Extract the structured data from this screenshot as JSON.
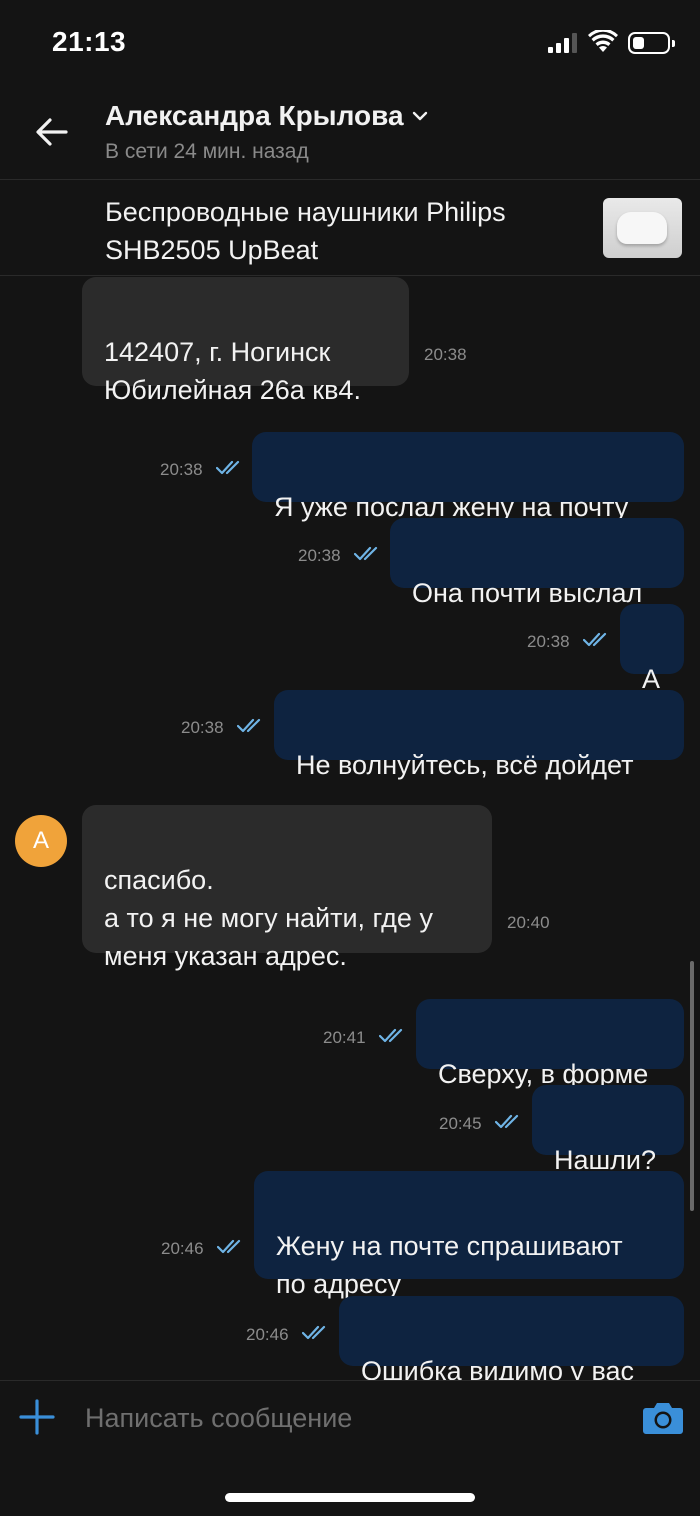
{
  "status_bar": {
    "time": "21:13",
    "battery_level": 0.35
  },
  "header": {
    "contact_name": "Александра Крылова",
    "contact_status": "В сети 24 мин. назад",
    "icons": [
      "back-arrow-icon",
      "chevron-down-icon"
    ]
  },
  "product": {
    "title": "Беспроводные наушники Philips SHB2505 UpBeat"
  },
  "avatar_letter": "А",
  "messages": [
    {
      "direction": "in",
      "text": "142407, г. Ногинск\nЮбилейная 26а кв4.",
      "time": "20:38"
    },
    {
      "direction": "out",
      "text": "Я уже послал жену на почту",
      "time": "20:38",
      "read": true
    },
    {
      "direction": "out",
      "text": "Она почти выслал",
      "time": "20:38",
      "read": true
    },
    {
      "direction": "out",
      "text": "А",
      "time": "20:38",
      "read": true
    },
    {
      "direction": "out",
      "text": "Не волнуйтесь, всё дойдет",
      "time": "20:38",
      "read": true
    },
    {
      "direction": "in",
      "text": "спасибо.\nа то я не могу найти, где у\nменя указан адрес.",
      "time": "20:40"
    },
    {
      "direction": "out",
      "text": "Сверху, в форме",
      "time": "20:41",
      "read": true
    },
    {
      "direction": "out",
      "text": "Нашли?",
      "time": "20:45",
      "read": true
    },
    {
      "direction": "out",
      "text": "Жену на почте спрашивают\nпо адресу",
      "time": "20:46",
      "read": true
    },
    {
      "direction": "out",
      "text": "Ошибка видимо у вас",
      "time": "20:46",
      "read": true
    }
  ],
  "composer": {
    "placeholder": "Написать сообщение",
    "icons": [
      "plus-icon",
      "camera-icon"
    ]
  },
  "colors": {
    "incoming_bubble": "#2b2b2b",
    "outgoing_bubble": "#0e2340",
    "tick": "#6fb4e6",
    "avatar": "#f0a33a",
    "accent": "#3a8fd9"
  }
}
